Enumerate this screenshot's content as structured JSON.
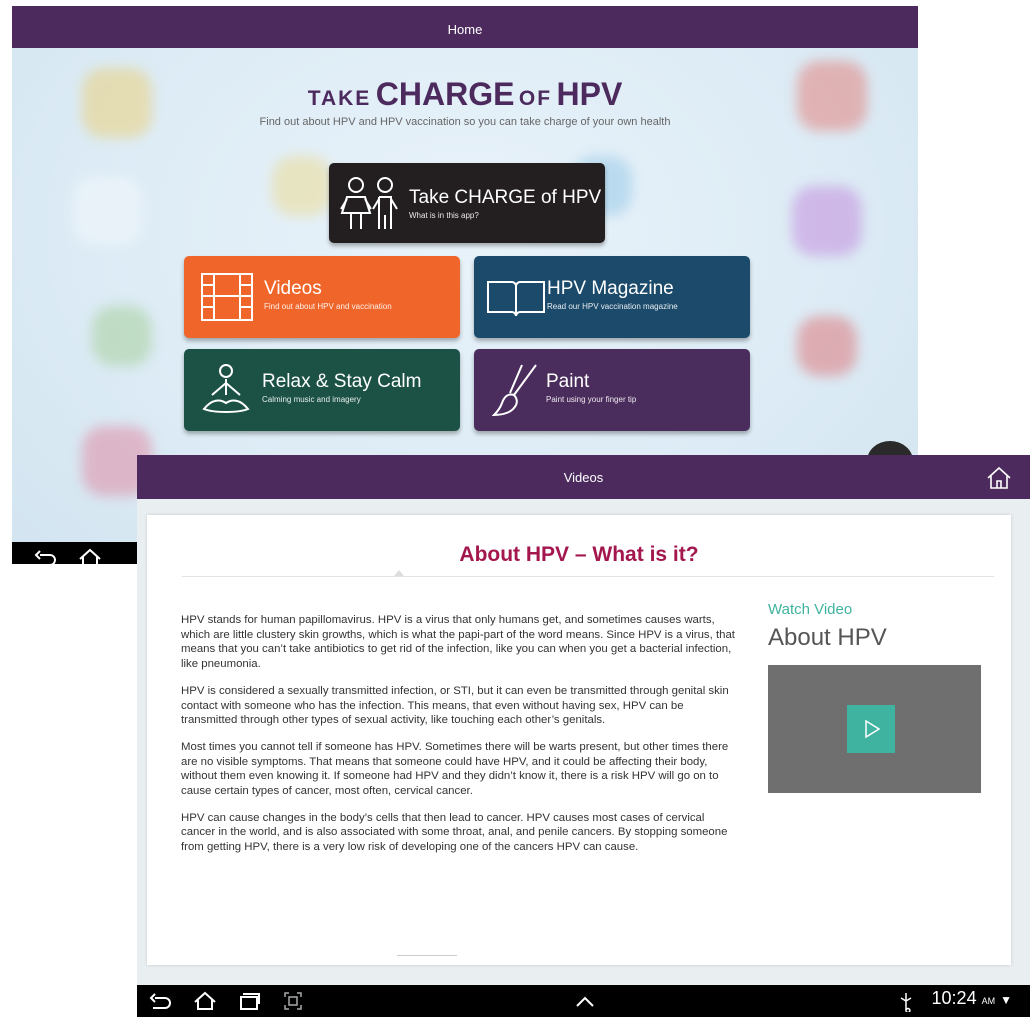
{
  "home": {
    "header_title": "Home",
    "title_small_1": "TAKE",
    "title_large_1": "CHARGE",
    "title_small_2": "OF",
    "title_large_2": "HPV",
    "subtitle": "Find out about HPV and HPV vaccination so you can take charge of your own health",
    "tiles": [
      {
        "title": "Take CHARGE of HPV",
        "subtitle": "What is in this app?",
        "color": "#231f20",
        "icon": "children-icon"
      },
      {
        "title": "Videos",
        "subtitle": "Find out about HPV and vaccination",
        "color": "#f0662a",
        "icon": "film-icon"
      },
      {
        "title": "HPV Magazine",
        "subtitle": "Read our HPV vaccination magazine",
        "color": "#1b4a6b",
        "icon": "book-icon"
      },
      {
        "title": "Relax & Stay Calm",
        "subtitle": "Calming music and imagery",
        "color": "#1c5245",
        "icon": "meditation-icon"
      },
      {
        "title": "Paint",
        "subtitle": "Paint using your finger tip",
        "color": "#4a2d5c",
        "icon": "paintbrush-icon"
      }
    ]
  },
  "videos": {
    "header_title": "Videos",
    "article_title": "About HPV – What is it?",
    "paragraphs": [
      "HPV stands for human papillomavirus. HPV is a virus that only humans get, and sometimes causes warts, which are little clustery skin growths, which is what the papi-part of the word means. Since HPV is a virus, that means that you can’t take antibiotics to get rid of the infection, like you can when you get a bacterial infection, like pneumonia.",
      "HPV is considered a sexually transmitted infection, or STI, but it can even be transmitted through genital skin contact with someone who has the infection. This means, that even without having sex, HPV can be transmitted through other types of sexual activity, like touching each other’s genitals.",
      "Most times you cannot tell if someone has HPV. Sometimes there will be warts present, but other times there are no visible symptoms. That means that someone could have HPV, and it could be affecting their body, without them even knowing it. If someone had HPV and they didn’t know it, there is a risk HPV will go on to cause certain types of cancer, most often, cervical cancer.",
      "HPV can cause changes in the body’s cells that then lead to cancer. HPV causes most cases of cervical cancer in the world, and is also associated with some throat, anal, and penile cancers. By stopping someone from getting HPV, there is a very low risk of developing one of the cancers HPV can cause."
    ],
    "watch_label": "Watch Video",
    "watch_title": "About HPV"
  },
  "status_bar": {
    "time": "10:24",
    "ampm": "AM"
  },
  "colors": {
    "header_purple": "#4c2a5d",
    "title_magenta": "#a3174e",
    "accent_teal": "#3fb3a0"
  }
}
